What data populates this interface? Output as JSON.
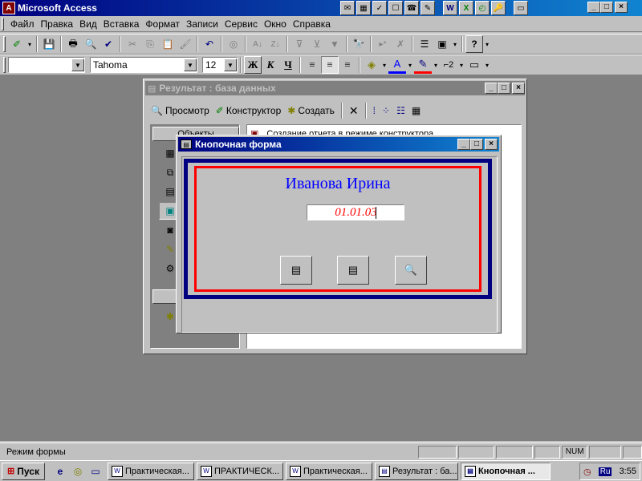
{
  "app": {
    "title": "Microsoft Access",
    "icon_letter": "A"
  },
  "quicklaunch": [
    "mail-icon",
    "calendar-icon",
    "task-icon",
    "note-icon",
    "contact-icon",
    "journal-icon",
    "word-icon",
    "excel-icon",
    "outlook-icon",
    "access-icon",
    "folder-icon"
  ],
  "quicklaunch_glyphs": [
    "✉",
    "▦",
    "✓",
    "☐",
    "☎",
    "✎",
    "W",
    "X",
    "◴",
    "🔑",
    "▭"
  ],
  "window_controls": {
    "minimize": "_",
    "maximize": "□",
    "close": "×"
  },
  "menu": {
    "items": [
      {
        "label": "Файл"
      },
      {
        "label": "Правка"
      },
      {
        "label": "Вид"
      },
      {
        "label": "Вставка"
      },
      {
        "label": "Формат"
      },
      {
        "label": "Записи"
      },
      {
        "label": "Сервис"
      },
      {
        "label": "Окно"
      },
      {
        "label": "Справка"
      }
    ]
  },
  "toolbar1": {
    "glyphs": [
      "✐",
      "▾",
      "💾",
      "🖶",
      "🔍",
      "✔",
      "✂",
      "⎘",
      "📋",
      "🖌",
      "↶",
      "◎",
      "A↓",
      "Z↓",
      "⊽",
      "⊻",
      "▼",
      "🔭",
      "▸*",
      "✗",
      "☰",
      "▣",
      "▾",
      "?",
      "▾"
    ]
  },
  "toolbar2": {
    "object_combo": "",
    "font_combo": "Tahoma",
    "size_combo": "12",
    "bold": "Ж",
    "italic": "К",
    "underline": "Ч",
    "align_left": "≡",
    "align_center": "≡",
    "align_right": "≡",
    "fill_color": "◈",
    "font_color": "A",
    "line_color": "✎",
    "border_width": "⌐2",
    "special_effect": "▭"
  },
  "db_window": {
    "title": "Результат : база данных",
    "toolbar": {
      "view": "Просмотр",
      "design": "Конструктор",
      "create": "Создать"
    },
    "objects_label": "Объекты",
    "list_item": "Создание отчета в режиме конструктора"
  },
  "form_window": {
    "title": "Кнопочная форма",
    "person_name": "Иванова Ирина",
    "date_value": "01.01.03",
    "buttons": [
      "▤",
      "▤",
      "🔍"
    ]
  },
  "statusbar": {
    "text": "Режим формы",
    "num": "NUM"
  },
  "taskbar": {
    "start_label": "Пуск",
    "tasks": [
      {
        "icon": "W",
        "label": "Практическая..."
      },
      {
        "icon": "W",
        "label": "ПРАКТИЧЕСК..."
      },
      {
        "icon": "W",
        "label": "Практическая..."
      },
      {
        "icon": "▤",
        "label": "Результат : ба..."
      },
      {
        "icon": "▤",
        "label": "Кнопочная ..."
      }
    ],
    "lang": "Ru",
    "clock": "3:55"
  }
}
